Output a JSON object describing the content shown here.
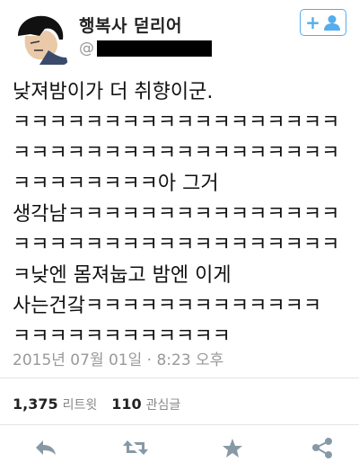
{
  "header": {
    "display_name": "행복사 덛리어",
    "handle_prefix": "@",
    "follow_icon": "add-user-icon",
    "follow_label": "+"
  },
  "tweet": {
    "lines": [
      "낮져밤이가 더 취향이군.",
      "ㅋㅋㅋㅋㅋㅋㅋㅋㅋㅋㅋㅋㅋㅋㅋㅋㅋㅋ",
      "ㅋㅋㅋㅋㅋㅋㅋㅋㅋㅋㅋㅋㅋㅋㅋㅋㅋㅋ",
      "ㅋㅋㅋㅋㅋㅋㅋㅋ아 그거",
      "생각남ㅋㅋㅋㅋㅋㅋㅋㅋㅋㅋㅋㅋㅋㅋㅋ",
      "ㅋㅋㅋㅋㅋㅋㅋㅋㅋㅋㅋㅋㅋㅋㅋㅋㅋㅋ",
      "ㅋ낮엔 몸져눕고 밤엔 이게",
      "사는건갘ㅋㅋㅋㅋㅋㅋㅋㅋㅋㅋㅋㅋㅋ",
      "ㅋㅋㅋㅋㅋㅋㅋㅋㅋㅋㅋㅋ"
    ],
    "timestamp": "2015년 07월 01일 · 8:23 오후"
  },
  "stats": {
    "retweets_count": "1,375",
    "retweets_label": "리트윗",
    "likes_count": "110",
    "likes_label": "관심글"
  },
  "actions": {
    "icons": [
      "reply-icon",
      "retweet-icon",
      "favorite-icon",
      "share-icon"
    ],
    "accent_color": "#55acee",
    "icon_color": "#8899a6"
  }
}
